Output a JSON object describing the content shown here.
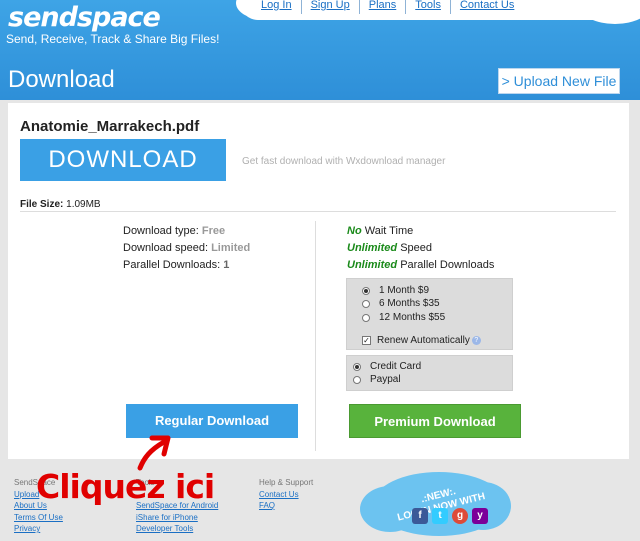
{
  "brand": {
    "logo": "sendspace",
    "tagline": "Send, Receive, Track & Share Big Files!"
  },
  "topnav": [
    "Log In",
    "Sign Up",
    "Plans",
    "Tools",
    "Contact Us"
  ],
  "page": {
    "title": "Download",
    "upload_button": "> Upload New File"
  },
  "file": {
    "name": "Anatomie_Marrakech.pdf",
    "download_label": "DOWNLOAD",
    "wx_note": "Get fast download with Wxdownload manager",
    "size_label": "File Size:",
    "size_value": "1.09MB"
  },
  "free": {
    "type_label": "Download type:",
    "type_value": "Free",
    "speed_label": "Download speed:",
    "speed_value": "Limited",
    "parallel_label": "Parallel Downloads:",
    "parallel_value": "1",
    "button": "Regular Download"
  },
  "premium": {
    "wait_em": "No",
    "wait_rest": "Wait Time",
    "speed_em": "Unlimited",
    "speed_rest": "Speed",
    "parallel_em": "Unlimited",
    "parallel_rest": "Parallel Downloads",
    "plans": [
      {
        "label": "1 Month $9",
        "selected": true
      },
      {
        "label": "6 Months $35",
        "selected": false
      },
      {
        "label": "12 Months $55",
        "selected": false
      }
    ],
    "renew_label": "Renew Automatically",
    "renew_checked": true,
    "payments": [
      {
        "label": "Credit Card",
        "selected": true
      },
      {
        "label": "Paypal",
        "selected": false
      }
    ],
    "button": "Premium Download"
  },
  "annotation": {
    "text": "Cliquez ici",
    "color": "#e00000"
  },
  "footer": {
    "col1": {
      "heading": "SendSpace",
      "links": [
        "Upload",
        "About Us",
        "Terms Of Use",
        "Privacy"
      ]
    },
    "col2": {
      "heading": "Tools",
      "links": [
        "SendSpace for Android",
        "iShare for iPhone",
        "Developer Tools"
      ]
    },
    "col3": {
      "heading": "Help & Support",
      "links": [
        "Contact Us",
        "FAQ"
      ]
    },
    "cloud_line1": ".:NEW:.",
    "cloud_line2": "LOG IN NOW WITH"
  },
  "colors": {
    "header_blue": "#2e8fd8",
    "button_blue": "#3aa0e5",
    "button_green": "#58b33c"
  }
}
